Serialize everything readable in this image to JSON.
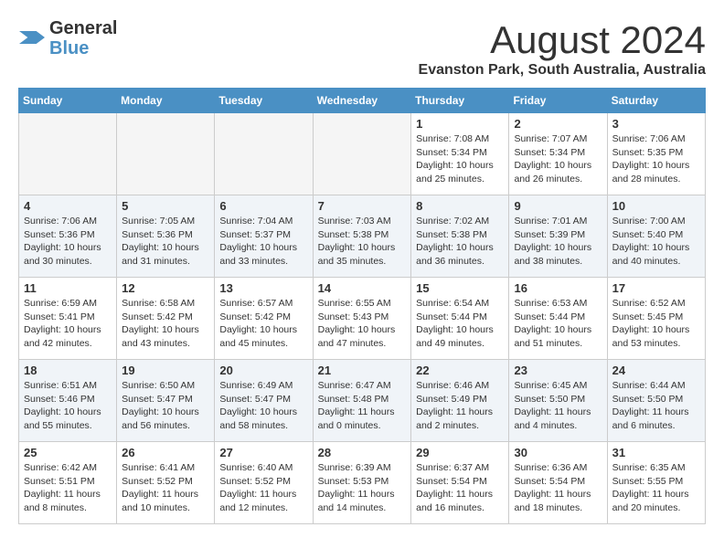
{
  "header": {
    "logo_general": "General",
    "logo_blue": "Blue",
    "month": "August 2024",
    "location": "Evanston Park, South Australia, Australia"
  },
  "days_of_week": [
    "Sunday",
    "Monday",
    "Tuesday",
    "Wednesday",
    "Thursday",
    "Friday",
    "Saturday"
  ],
  "weeks": [
    {
      "days": [
        {
          "number": "",
          "info": ""
        },
        {
          "number": "",
          "info": ""
        },
        {
          "number": "",
          "info": ""
        },
        {
          "number": "",
          "info": ""
        },
        {
          "number": "1",
          "info": "Sunrise: 7:08 AM\nSunset: 5:34 PM\nDaylight: 10 hours\nand 25 minutes."
        },
        {
          "number": "2",
          "info": "Sunrise: 7:07 AM\nSunset: 5:34 PM\nDaylight: 10 hours\nand 26 minutes."
        },
        {
          "number": "3",
          "info": "Sunrise: 7:06 AM\nSunset: 5:35 PM\nDaylight: 10 hours\nand 28 minutes."
        }
      ]
    },
    {
      "days": [
        {
          "number": "4",
          "info": "Sunrise: 7:06 AM\nSunset: 5:36 PM\nDaylight: 10 hours\nand 30 minutes."
        },
        {
          "number": "5",
          "info": "Sunrise: 7:05 AM\nSunset: 5:36 PM\nDaylight: 10 hours\nand 31 minutes."
        },
        {
          "number": "6",
          "info": "Sunrise: 7:04 AM\nSunset: 5:37 PM\nDaylight: 10 hours\nand 33 minutes."
        },
        {
          "number": "7",
          "info": "Sunrise: 7:03 AM\nSunset: 5:38 PM\nDaylight: 10 hours\nand 35 minutes."
        },
        {
          "number": "8",
          "info": "Sunrise: 7:02 AM\nSunset: 5:38 PM\nDaylight: 10 hours\nand 36 minutes."
        },
        {
          "number": "9",
          "info": "Sunrise: 7:01 AM\nSunset: 5:39 PM\nDaylight: 10 hours\nand 38 minutes."
        },
        {
          "number": "10",
          "info": "Sunrise: 7:00 AM\nSunset: 5:40 PM\nDaylight: 10 hours\nand 40 minutes."
        }
      ]
    },
    {
      "days": [
        {
          "number": "11",
          "info": "Sunrise: 6:59 AM\nSunset: 5:41 PM\nDaylight: 10 hours\nand 42 minutes."
        },
        {
          "number": "12",
          "info": "Sunrise: 6:58 AM\nSunset: 5:42 PM\nDaylight: 10 hours\nand 43 minutes."
        },
        {
          "number": "13",
          "info": "Sunrise: 6:57 AM\nSunset: 5:42 PM\nDaylight: 10 hours\nand 45 minutes."
        },
        {
          "number": "14",
          "info": "Sunrise: 6:55 AM\nSunset: 5:43 PM\nDaylight: 10 hours\nand 47 minutes."
        },
        {
          "number": "15",
          "info": "Sunrise: 6:54 AM\nSunset: 5:44 PM\nDaylight: 10 hours\nand 49 minutes."
        },
        {
          "number": "16",
          "info": "Sunrise: 6:53 AM\nSunset: 5:44 PM\nDaylight: 10 hours\nand 51 minutes."
        },
        {
          "number": "17",
          "info": "Sunrise: 6:52 AM\nSunset: 5:45 PM\nDaylight: 10 hours\nand 53 minutes."
        }
      ]
    },
    {
      "days": [
        {
          "number": "18",
          "info": "Sunrise: 6:51 AM\nSunset: 5:46 PM\nDaylight: 10 hours\nand 55 minutes."
        },
        {
          "number": "19",
          "info": "Sunrise: 6:50 AM\nSunset: 5:47 PM\nDaylight: 10 hours\nand 56 minutes."
        },
        {
          "number": "20",
          "info": "Sunrise: 6:49 AM\nSunset: 5:47 PM\nDaylight: 10 hours\nand 58 minutes."
        },
        {
          "number": "21",
          "info": "Sunrise: 6:47 AM\nSunset: 5:48 PM\nDaylight: 11 hours\nand 0 minutes."
        },
        {
          "number": "22",
          "info": "Sunrise: 6:46 AM\nSunset: 5:49 PM\nDaylight: 11 hours\nand 2 minutes."
        },
        {
          "number": "23",
          "info": "Sunrise: 6:45 AM\nSunset: 5:50 PM\nDaylight: 11 hours\nand 4 minutes."
        },
        {
          "number": "24",
          "info": "Sunrise: 6:44 AM\nSunset: 5:50 PM\nDaylight: 11 hours\nand 6 minutes."
        }
      ]
    },
    {
      "days": [
        {
          "number": "25",
          "info": "Sunrise: 6:42 AM\nSunset: 5:51 PM\nDaylight: 11 hours\nand 8 minutes."
        },
        {
          "number": "26",
          "info": "Sunrise: 6:41 AM\nSunset: 5:52 PM\nDaylight: 11 hours\nand 10 minutes."
        },
        {
          "number": "27",
          "info": "Sunrise: 6:40 AM\nSunset: 5:52 PM\nDaylight: 11 hours\nand 12 minutes."
        },
        {
          "number": "28",
          "info": "Sunrise: 6:39 AM\nSunset: 5:53 PM\nDaylight: 11 hours\nand 14 minutes."
        },
        {
          "number": "29",
          "info": "Sunrise: 6:37 AM\nSunset: 5:54 PM\nDaylight: 11 hours\nand 16 minutes."
        },
        {
          "number": "30",
          "info": "Sunrise: 6:36 AM\nSunset: 5:54 PM\nDaylight: 11 hours\nand 18 minutes."
        },
        {
          "number": "31",
          "info": "Sunrise: 6:35 AM\nSunset: 5:55 PM\nDaylight: 11 hours\nand 20 minutes."
        }
      ]
    }
  ]
}
